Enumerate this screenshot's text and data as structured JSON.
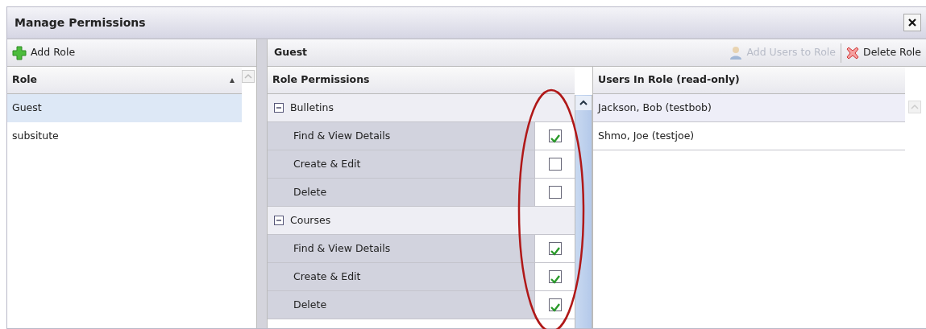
{
  "window": {
    "title": "Manage Permissions"
  },
  "roles_panel": {
    "add_button": {
      "label": "Add Role"
    },
    "column": "Role",
    "sorted_ascending": true,
    "rows": [
      {
        "name": "Guest",
        "selected": true
      },
      {
        "name": "subsitute",
        "selected": false
      }
    ]
  },
  "detail": {
    "title": "Guest",
    "toolbar": [
      {
        "label": "Add Users to Role",
        "kind": "add-users",
        "disabled": true
      },
      {
        "label": "Delete Role",
        "kind": "delete",
        "disabled": false
      }
    ],
    "permissions": {
      "column": "Role Permissions",
      "groups": [
        {
          "name": "Bulletins",
          "expanded": true,
          "items": [
            {
              "label": "Find & View Details",
              "checked": true
            },
            {
              "label": "Create & Edit",
              "checked": false
            },
            {
              "label": "Delete",
              "checked": false
            }
          ]
        },
        {
          "name": "Courses",
          "expanded": true,
          "items": [
            {
              "label": "Find & View Details",
              "checked": true
            },
            {
              "label": "Create & Edit",
              "checked": true
            },
            {
              "label": "Delete",
              "checked": true
            }
          ]
        }
      ]
    },
    "users": {
      "column": "Users In Role (read-only)",
      "rows": [
        {
          "name": "Jackson, Bob (testbob)",
          "selected": true
        },
        {
          "name": "Shmo, Joe (testjoe)",
          "selected": false
        }
      ]
    }
  }
}
